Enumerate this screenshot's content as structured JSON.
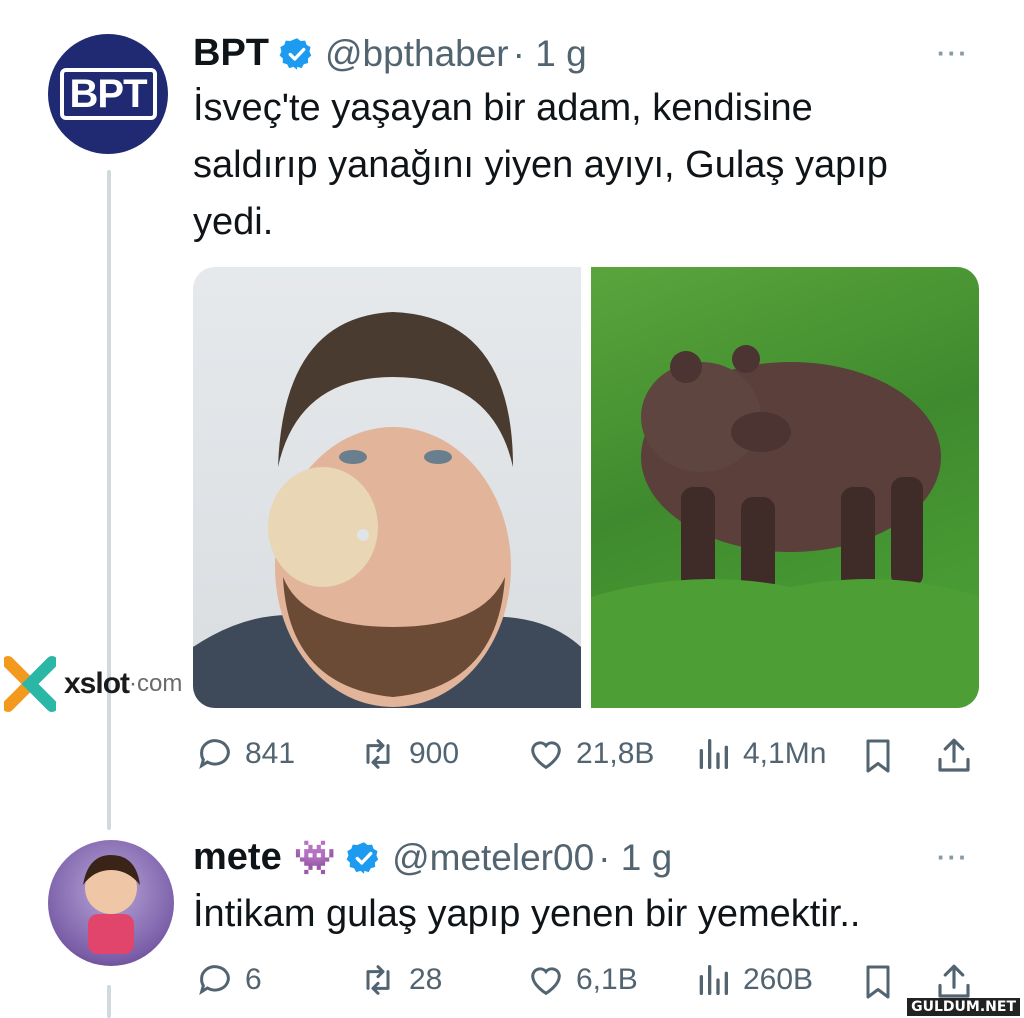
{
  "tweets": [
    {
      "name": "BPT",
      "handle": "@bpthaber",
      "time": "· 1 g",
      "avatar_text": "BPT",
      "lines": [
        "İsveç'te yaşayan bir adam, kendisine",
        "saldırıp yanağını yiyen ayıyı, Gulaş yapıp",
        "yedi."
      ],
      "replies": "841",
      "retweets": "900",
      "likes": "21,8B",
      "views": "4,1Mn"
    },
    {
      "name": "mete",
      "emoji": "👾",
      "handle": "@meteler00",
      "time": "· 1 g",
      "lines": [
        "İntikam gulaş yapıp yenen bir yemektir.."
      ],
      "replies": "6",
      "retweets": "28",
      "likes": "6,1B",
      "views": "260B"
    }
  ],
  "more_icon": "···",
  "watermark": {
    "brand": "xslot",
    "suffix": "·com"
  },
  "corner_watermark": "GULDUM.NET",
  "colors": {
    "verified": "#1d9bf0",
    "muted": "#536471",
    "thread": "#cfd9de",
    "bpt_navy": "#1f2a73"
  }
}
